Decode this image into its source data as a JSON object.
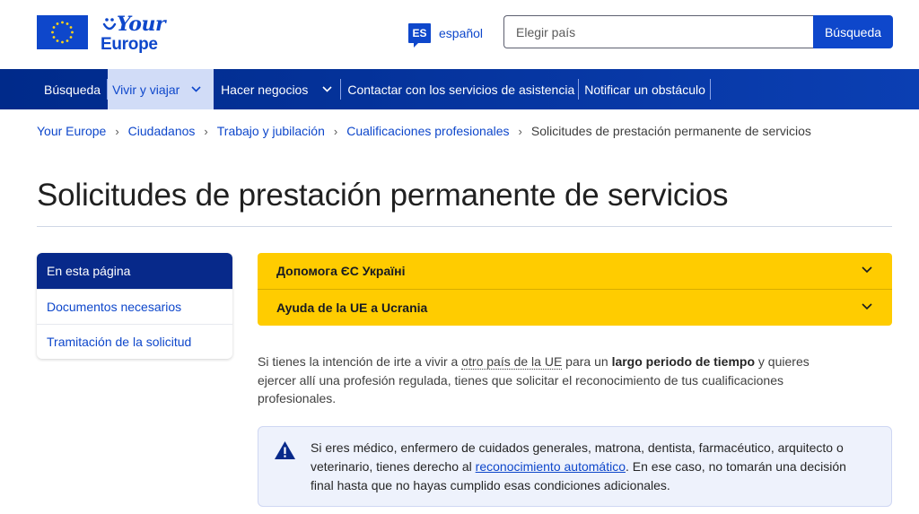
{
  "header": {
    "logo_line1": "Your",
    "logo_line2": "Europe",
    "lang_code": "ES",
    "lang_label": "español",
    "search_placeholder": "Elegir país",
    "search_button": "Búsqueda"
  },
  "nav": {
    "items": [
      {
        "label": "Búsqueda"
      },
      {
        "label": "Vivir y viajar"
      },
      {
        "label": "Hacer negocios"
      },
      {
        "label": "Contactar con los servicios de asistencia"
      },
      {
        "label": "Notificar un obstáculo"
      }
    ]
  },
  "breadcrumb": {
    "items": [
      "Your Europe",
      "Ciudadanos",
      "Trabajo y jubilación",
      "Cualificaciones profesionales"
    ],
    "current": "Solicitudes de prestación permanente de servicios"
  },
  "page_title": "Solicitudes de prestación permanente de servicios",
  "sidebar": {
    "heading": "En esta página",
    "items": [
      {
        "label": "Documentos necesarios"
      },
      {
        "label": "Tramitación de la solicitud"
      }
    ]
  },
  "accordions": [
    {
      "label": "Допомога ЄС Україні"
    },
    {
      "label": "Ayuda de la UE a Ucrania"
    }
  ],
  "intro": {
    "t1": "Si tienes la intención de irte a vivir a ",
    "link": "otro país de la UE",
    "t2": " para un ",
    "bold": "largo periodo de tiempo",
    "t3": " y quieres ejercer allí una profesión regulada, tienes que solicitar el reconocimiento de tus cualificaciones profesionales."
  },
  "notice": {
    "t1": "Si eres médico, enfermero de cuidados generales, matrona, dentista, farmacéutico, arquitecto o veterinario, tienes derecho al ",
    "link": "reconocimiento automático",
    "t2": ". En ese caso, no tomarán una decisión final hasta que no hayas cumplido esas condiciones adicionales."
  },
  "colors": {
    "brand_blue": "#0e47cb",
    "nav_dark": "#002a8a",
    "accordion_yellow": "#ffcc00",
    "notice_bg": "#eef2fc"
  }
}
